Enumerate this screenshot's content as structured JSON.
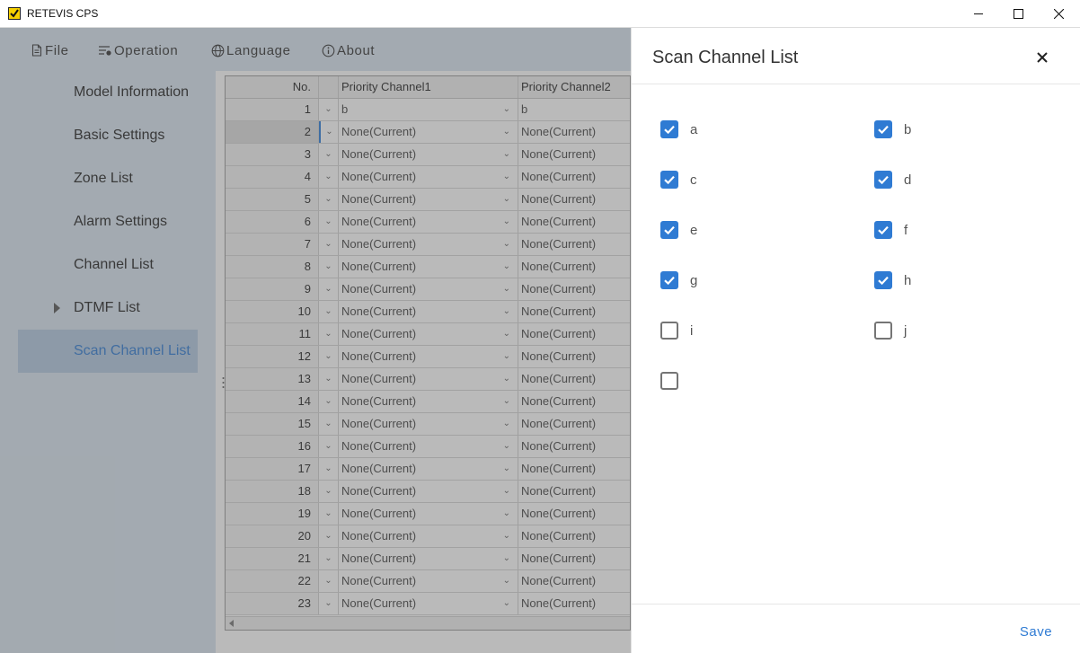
{
  "window": {
    "title": "RETEVIS CPS"
  },
  "menu": [
    {
      "label": "File",
      "icon": "file-icon"
    },
    {
      "label": "Operation",
      "icon": "operation-icon"
    },
    {
      "label": "Language",
      "icon": "globe-icon"
    },
    {
      "label": "About",
      "icon": "info-icon"
    }
  ],
  "sidebar": {
    "items": [
      {
        "label": "Model Information"
      },
      {
        "label": "Basic Settings"
      },
      {
        "label": "Zone List"
      },
      {
        "label": "Alarm Settings"
      },
      {
        "label": "Channel List"
      },
      {
        "label": "DTMF List",
        "expandable": true
      },
      {
        "label": "Scan Channel List",
        "active": true
      }
    ]
  },
  "table": {
    "headers": {
      "no": "No.",
      "priority1": "Priority Channel1",
      "priority2": "Priority Channel2"
    },
    "rows": [
      {
        "no": "1",
        "p1": "b",
        "p2": "b"
      },
      {
        "no": "2",
        "p1": "None(Current)",
        "p2": "None(Current)",
        "selected": true
      },
      {
        "no": "3",
        "p1": "None(Current)",
        "p2": "None(Current)"
      },
      {
        "no": "4",
        "p1": "None(Current)",
        "p2": "None(Current)"
      },
      {
        "no": "5",
        "p1": "None(Current)",
        "p2": "None(Current)"
      },
      {
        "no": "6",
        "p1": "None(Current)",
        "p2": "None(Current)"
      },
      {
        "no": "7",
        "p1": "None(Current)",
        "p2": "None(Current)"
      },
      {
        "no": "8",
        "p1": "None(Current)",
        "p2": "None(Current)"
      },
      {
        "no": "9",
        "p1": "None(Current)",
        "p2": "None(Current)"
      },
      {
        "no": "10",
        "p1": "None(Current)",
        "p2": "None(Current)"
      },
      {
        "no": "11",
        "p1": "None(Current)",
        "p2": "None(Current)"
      },
      {
        "no": "12",
        "p1": "None(Current)",
        "p2": "None(Current)"
      },
      {
        "no": "13",
        "p1": "None(Current)",
        "p2": "None(Current)"
      },
      {
        "no": "14",
        "p1": "None(Current)",
        "p2": "None(Current)"
      },
      {
        "no": "15",
        "p1": "None(Current)",
        "p2": "None(Current)"
      },
      {
        "no": "16",
        "p1": "None(Current)",
        "p2": "None(Current)"
      },
      {
        "no": "17",
        "p1": "None(Current)",
        "p2": "None(Current)"
      },
      {
        "no": "18",
        "p1": "None(Current)",
        "p2": "None(Current)"
      },
      {
        "no": "19",
        "p1": "None(Current)",
        "p2": "None(Current)"
      },
      {
        "no": "20",
        "p1": "None(Current)",
        "p2": "None(Current)"
      },
      {
        "no": "21",
        "p1": "None(Current)",
        "p2": "None(Current)"
      },
      {
        "no": "22",
        "p1": "None(Current)",
        "p2": "None(Current)"
      },
      {
        "no": "23",
        "p1": "None(Current)",
        "p2": "None(Current)"
      }
    ]
  },
  "panel": {
    "title": "Scan Channel List",
    "checkboxes": [
      {
        "label": "a",
        "checked": true
      },
      {
        "label": "b",
        "checked": true
      },
      {
        "label": "c",
        "checked": true
      },
      {
        "label": "d",
        "checked": true
      },
      {
        "label": "e",
        "checked": true
      },
      {
        "label": "f",
        "checked": true
      },
      {
        "label": "g",
        "checked": true
      },
      {
        "label": "h",
        "checked": true
      },
      {
        "label": "i",
        "checked": false
      },
      {
        "label": "j",
        "checked": false
      },
      {
        "label": "",
        "checked": false
      }
    ],
    "save_label": "Save"
  },
  "colors": {
    "accent": "#2f7bd3",
    "app_background": "#d7e3ef",
    "overlay": "#5a5a5a"
  }
}
